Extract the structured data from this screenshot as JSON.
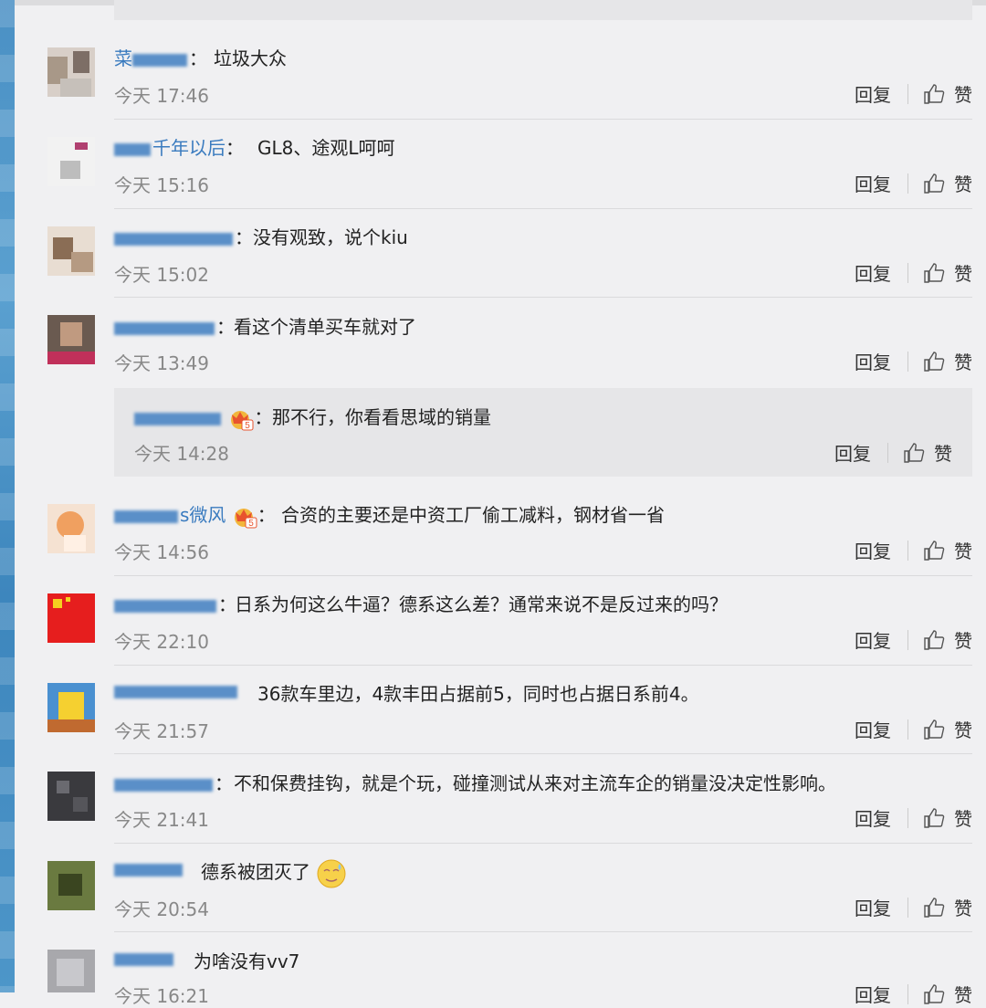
{
  "comments": [
    {
      "name": "菜",
      "sep": "：",
      "text": "垃圾大众",
      "time": "今天 17:46"
    },
    {
      "name": "千年以后",
      "sep": "：",
      "text": "GL8、途观L呵呵",
      "time": "今天 15:16"
    },
    {
      "name": "",
      "sep": "：",
      "text": "没有观致，说个kiu",
      "time": "今天 15:02"
    },
    {
      "name": "",
      "sep": "：",
      "text": "看这个清单买车就对了",
      "time": "今天 13:49"
    },
    {
      "name": "s微风",
      "sep": "：",
      "text": "合资的主要还是中资工厂偷工减料，钢材省一省",
      "time": "今天 14:56"
    },
    {
      "name": "",
      "sep": "：",
      "text": "日系为何这么牛逼？德系这么差？通常来说不是反过来的吗？",
      "time": "今天 22:10"
    },
    {
      "name": "",
      "sep": "",
      "text": "36款车里边，4款丰田占据前5，同时也占据日系前4。",
      "time": "今天 21:57"
    },
    {
      "name": "",
      "sep": "：",
      "text": "不和保费挂钩，就是个玩，碰撞测试从来对主流车企的销量没决定性影响。",
      "time": "今天 21:41"
    },
    {
      "name": "",
      "sep": "",
      "text": "德系被团灭了",
      "time": "今天 20:54"
    },
    {
      "name": "",
      "sep": "",
      "text": "为啥没有vv7",
      "time": "今天 16:21"
    }
  ],
  "sub_reply": {
    "name": "",
    "sep": "：",
    "text": "那不行，你看看思域的销量",
    "time": "今天 14:28"
  },
  "actions": {
    "reply": "回复",
    "like": "赞"
  },
  "badge_level": "5",
  "colors": {
    "name": "#3a7bbf",
    "time": "#888888",
    "text": "#222222",
    "bg": "#f0f0f2"
  }
}
